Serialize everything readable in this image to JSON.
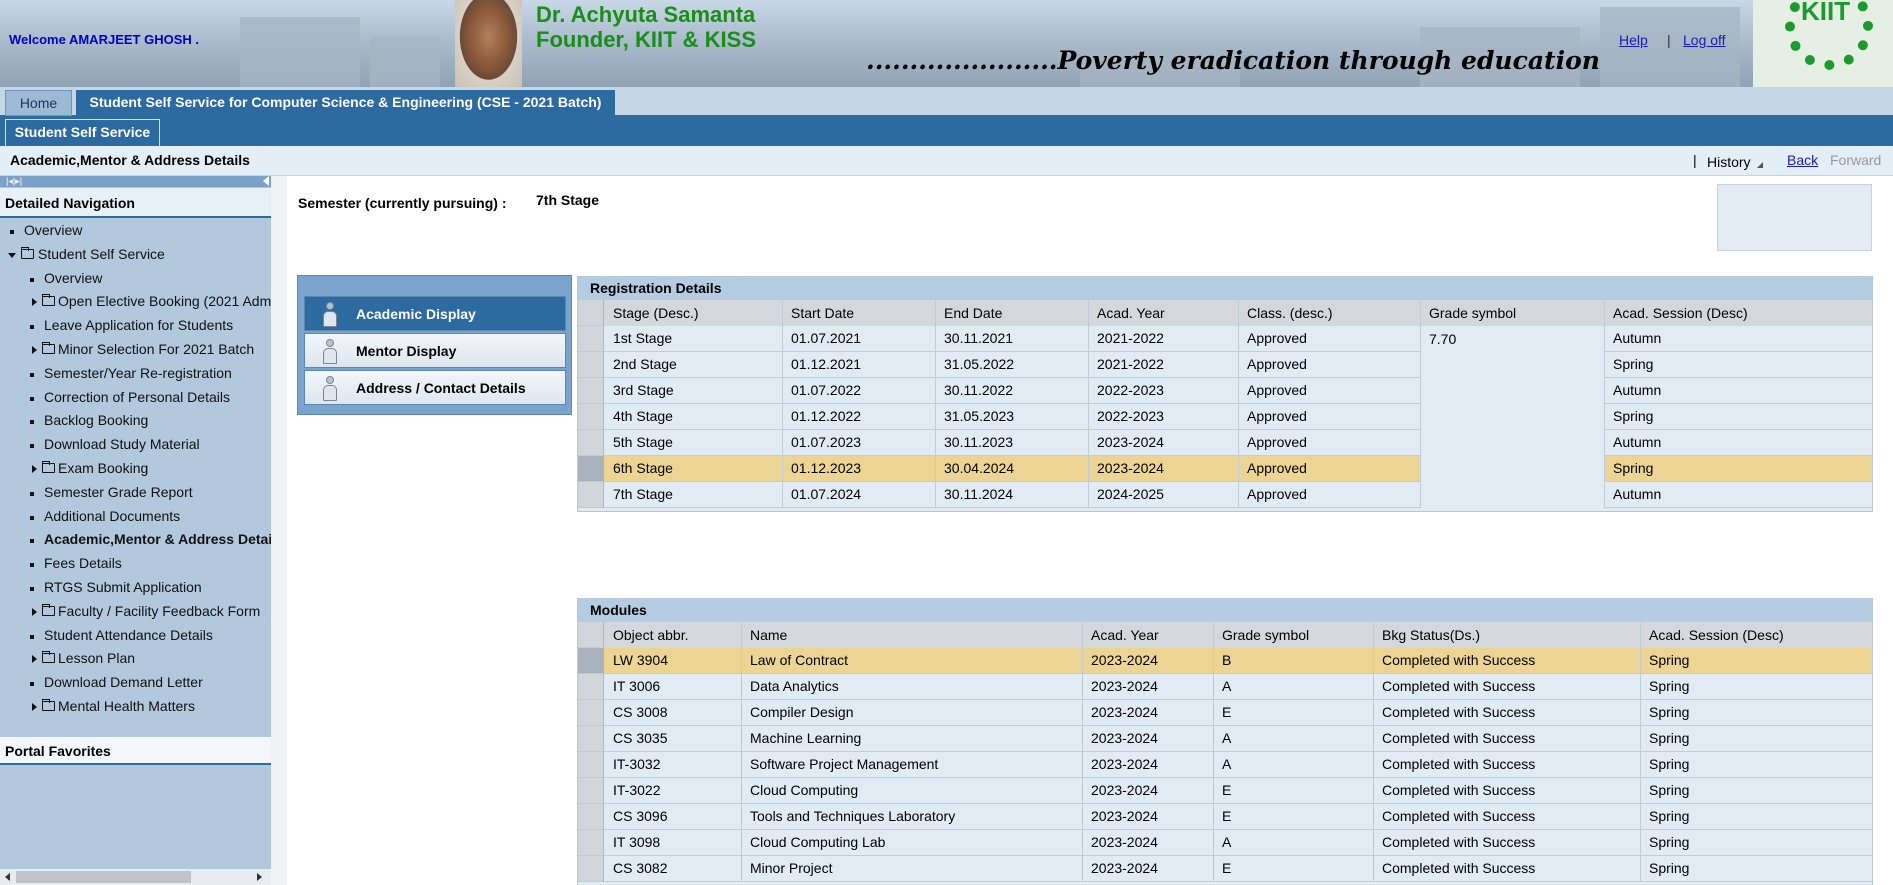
{
  "header": {
    "welcome": "Welcome AMARJEET GHOSH .",
    "founder_name": "Dr. Achyuta Samanta",
    "founder_title": "Founder, KIIT & KISS",
    "motto": "......................Poverty eradication through education",
    "help": "Help",
    "separator": "|",
    "logoff": "Log off",
    "logo_text": "KIIT"
  },
  "tabs": {
    "home": "Home",
    "sss_cse": "Student Self Service for Computer Science & Engineering (CSE - 2021 Batch)",
    "sss": "Student Self Service"
  },
  "titlebar": {
    "title": "Academic,Mentor & Address Details",
    "separator": "|",
    "history": "History",
    "back": "Back",
    "forward": "Forward"
  },
  "sidebar": {
    "toggle_icons": "|◂|▸|",
    "header": "Detailed Navigation",
    "items": [
      {
        "label": "Overview",
        "type": "bullet",
        "level": 0
      },
      {
        "label": "Student Self Service",
        "type": "folder-open",
        "level": 0
      },
      {
        "label": "Overview",
        "type": "bullet",
        "level": 1
      },
      {
        "label": "Open Elective Booking (2021 Adm",
        "type": "folder",
        "level": 1
      },
      {
        "label": "Leave Application for Students",
        "type": "bullet",
        "level": 1
      },
      {
        "label": "Minor Selection For 2021 Batch",
        "type": "folder",
        "level": 1
      },
      {
        "label": "Semester/Year Re-registration",
        "type": "bullet",
        "level": 1
      },
      {
        "label": "Correction of Personal Details",
        "type": "bullet",
        "level": 1
      },
      {
        "label": "Backlog Booking",
        "type": "bullet",
        "level": 1
      },
      {
        "label": "Download Study Material",
        "type": "bullet",
        "level": 1
      },
      {
        "label": "Exam Booking",
        "type": "folder",
        "level": 1
      },
      {
        "label": "Semester Grade Report",
        "type": "bullet",
        "level": 1
      },
      {
        "label": "Additional Documents",
        "type": "bullet",
        "level": 1
      },
      {
        "label": "Academic,Mentor & Address Detai",
        "type": "bullet",
        "level": 1,
        "selected": true
      },
      {
        "label": "Fees Details",
        "type": "bullet",
        "level": 1
      },
      {
        "label": "RTGS Submit Application",
        "type": "bullet",
        "level": 1
      },
      {
        "label": "Faculty / Facility Feedback Form",
        "type": "folder",
        "level": 1
      },
      {
        "label": "Student Attendance Details",
        "type": "bullet",
        "level": 1
      },
      {
        "label": "Lesson Plan",
        "type": "folder",
        "level": 1
      },
      {
        "label": "Download Demand Letter",
        "type": "bullet",
        "level": 1
      },
      {
        "label": "Mental Health Matters",
        "type": "folder",
        "level": 1
      }
    ],
    "favorites_header": "Portal Favorites"
  },
  "main": {
    "semester_label": "Semester (currently pursuing) :",
    "semester_value": "7th Stage",
    "vtabs": [
      {
        "label": "Academic Display",
        "active": true
      },
      {
        "label": "Mentor Display",
        "active": false
      },
      {
        "label": "Address / Contact Details",
        "active": false
      }
    ]
  },
  "registration": {
    "title": "Registration Details",
    "columns": [
      "Stage (Desc.)",
      "Start Date",
      "End Date",
      "Acad. Year",
      "Class. (desc.)",
      "Grade symbol",
      "Acad. Session (Desc)"
    ],
    "grade_symbol": "7.70",
    "rows": [
      [
        "1st Stage",
        "01.07.2021",
        "30.11.2021",
        "2021-2022",
        "Approved",
        "Autumn"
      ],
      [
        "2nd Stage",
        "01.12.2021",
        "31.05.2022",
        "2021-2022",
        "Approved",
        "Spring"
      ],
      [
        "3rd Stage",
        "01.07.2022",
        "30.11.2022",
        "2022-2023",
        "Approved",
        "Autumn"
      ],
      [
        "4th Stage",
        "01.12.2022",
        "31.05.2023",
        "2022-2023",
        "Approved",
        "Spring"
      ],
      [
        "5th Stage",
        "01.07.2023",
        "30.11.2023",
        "2023-2024",
        "Approved",
        "Autumn"
      ],
      [
        "6th Stage",
        "01.12.2023",
        "30.04.2024",
        "2023-2024",
        "Approved",
        "Spring"
      ],
      [
        "7th Stage",
        "01.07.2024",
        "30.11.2024",
        "2024-2025",
        "Approved",
        "Autumn"
      ]
    ],
    "highlight_row": 5
  },
  "modules": {
    "title": "Modules",
    "columns": [
      "Object abbr.",
      "Name",
      "Acad. Year",
      "Grade symbol",
      "Bkg Status(Ds.)",
      "Acad. Session (Desc)"
    ],
    "rows": [
      [
        "LW 3904",
        "Law of Contract",
        "2023-2024",
        "B",
        "Completed with Success",
        "Spring"
      ],
      [
        "IT 3006",
        "Data Analytics",
        "2023-2024",
        "A",
        "Completed with Success",
        "Spring"
      ],
      [
        "CS 3008",
        "Compiler Design",
        "2023-2024",
        "E",
        "Completed with Success",
        "Spring"
      ],
      [
        "CS 3035",
        "Machine Learning",
        "2023-2024",
        "A",
        "Completed with Success",
        "Spring"
      ],
      [
        "IT-3032",
        "Software Project Management",
        "2023-2024",
        "A",
        "Completed with Success",
        "Spring"
      ],
      [
        "IT-3022",
        "Cloud Computing",
        "2023-2024",
        "E",
        "Completed with Success",
        "Spring"
      ],
      [
        "CS 3096",
        "Tools and Techniques Laboratory",
        "2023-2024",
        "E",
        "Completed with Success",
        "Spring"
      ],
      [
        "IT 3098",
        "Cloud Computing Lab",
        "2023-2024",
        "A",
        "Completed with Success",
        "Spring"
      ],
      [
        "CS 3082",
        "Minor Project",
        "2023-2024",
        "E",
        "Completed with Success",
        "Spring"
      ]
    ],
    "highlight_row": 0
  }
}
